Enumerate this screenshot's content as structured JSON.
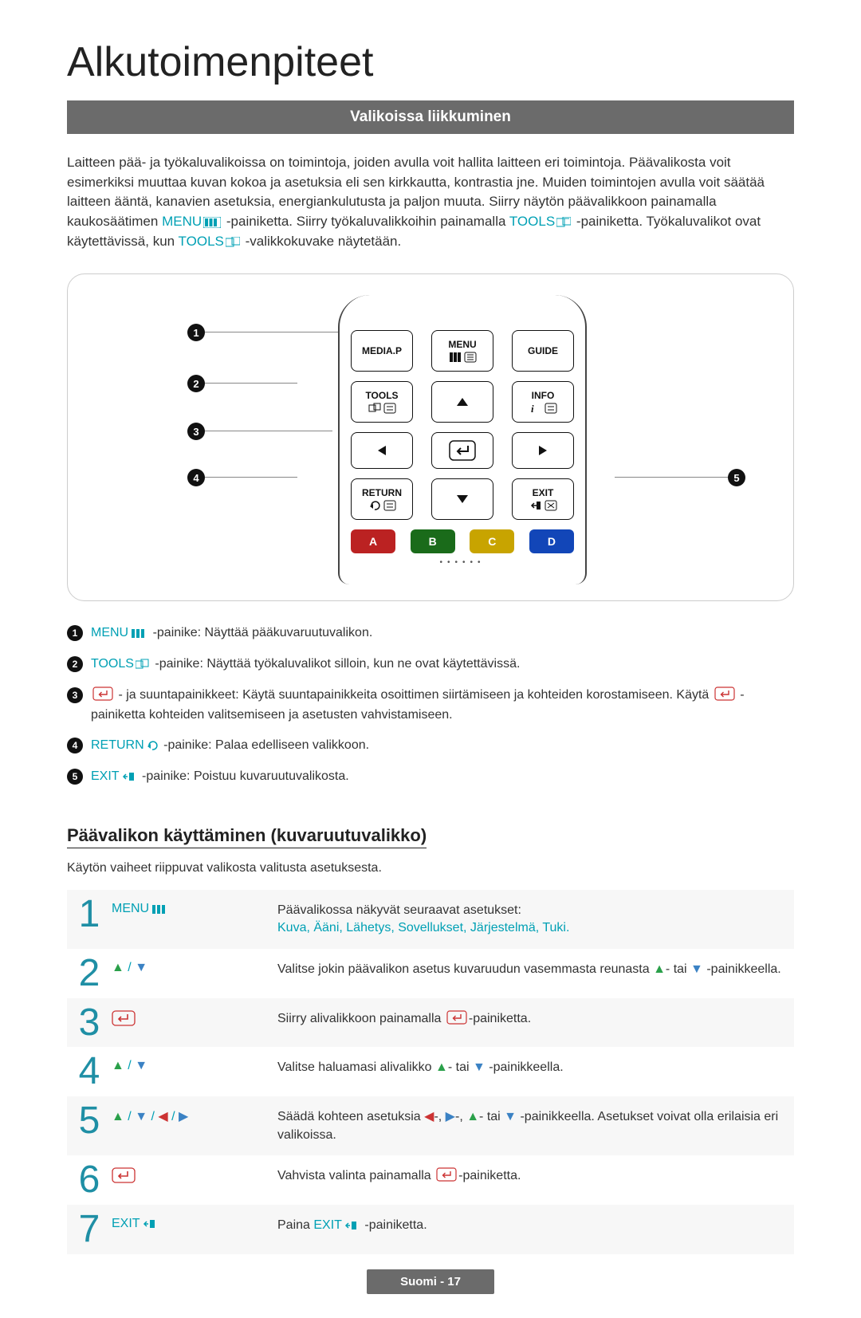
{
  "title": "Alkutoimenpiteet",
  "section_heading": "Valikoissa liikkuminen",
  "intro": {
    "text_before_menu": "Laitteen pää- ja työkaluvalikoissa on toimintoja, joiden avulla voit hallita laitteen eri toimintoja. Päävalikosta voit esimerkiksi muuttaa kuvan kokoa ja asetuksia eli sen kirkkautta, kontrastia jne. Muiden toimintojen avulla voit säätää laitteen ääntä, kanavien asetuksia, energiankulutusta ja paljon muuta. Siirry näytön päävalikkoon painamalla kaukosäätimen ",
    "menu_label": "MENU",
    "text_between": " -painiketta. Siirry työkaluvalikkoihin painamalla ",
    "tools_label": "TOOLS",
    "text_after_tools": " -painiketta. Työkaluvalikot ovat käytettävissä, kun ",
    "tools_label2": "TOOLS",
    "text_end": " -valikkokuvake näytetään."
  },
  "remote": {
    "buttons": {
      "media_p": "MEDIA.P",
      "menu": "MENU",
      "guide": "GUIDE",
      "tools": "TOOLS",
      "info": "INFO",
      "return": "RETURN",
      "exit": "EXIT"
    },
    "color_buttons": {
      "a": "A",
      "b": "B",
      "c": "C",
      "d": "D"
    },
    "callouts": {
      "n1": "1",
      "n2": "2",
      "n3": "3",
      "n4": "4",
      "n5": "5"
    }
  },
  "legend": [
    {
      "pre": "MENU",
      "text": " -painike: Näyttää pääkuvaruutuvalikon."
    },
    {
      "pre": "TOOLS",
      "text": " -painike: Näyttää työkaluvalikot silloin, kun ne ovat käytettävissä."
    },
    {
      "pre": "",
      "text": "- ja suuntapainikkeet: Käytä suuntapainikkeita osoittimen siirtämiseen ja kohteiden korostamiseen. Käytä ",
      "text2": "-painiketta kohteiden valitsemiseen ja asetusten vahvistamiseen."
    },
    {
      "pre": "RETURN",
      "text": " -painike: Palaa edelliseen valikkoon."
    },
    {
      "pre": "EXIT",
      "text": " -painike: Poistuu kuvaruutuvalikosta."
    }
  ],
  "sub_heading": "Päävalikon käyttäminen (kuvaruutuvalikko)",
  "sub_note": "Käytön vaiheet riippuvat valikosta valitusta asetuksesta.",
  "steps": [
    {
      "num": "1",
      "action": "MENU",
      "action_icon": "menu-icon",
      "desc_lead": "Päävalikossa näkyvät seuraavat asetukset:",
      "desc_links": "Kuva, Ääni, Lähetys, Sovellukset, Järjestelmä, Tuki."
    },
    {
      "num": "2",
      "action_icons": "updown",
      "desc_a": "Valitse jokin päävalikon asetus kuvaruudun vasemmasta reunasta ",
      "desc_b": "- tai ",
      "desc_c": " -painikkeella."
    },
    {
      "num": "3",
      "action_icons": "enter",
      "desc_a": "Siirry alivalikkoon painamalla ",
      "desc_b": "-painiketta."
    },
    {
      "num": "4",
      "action_icons": "updown",
      "desc_a": "Valitse haluamasi alivalikko ",
      "desc_b": "- tai ",
      "desc_c": " -painikkeella."
    },
    {
      "num": "5",
      "action_icons": "all4",
      "desc_a": "Säädä kohteen asetuksia ",
      "desc_b": "-, ",
      "desc_c": "-, ",
      "desc_d": "- tai ",
      "desc_e": " -painikkeella. Asetukset voivat olla erilaisia eri valikoissa."
    },
    {
      "num": "6",
      "action_icons": "enter",
      "desc_a": "Vahvista valinta painamalla ",
      "desc_b": "-painiketta."
    },
    {
      "num": "7",
      "action": "EXIT",
      "action_icon": "exit-icon",
      "desc_a": "Paina ",
      "desc_mid": "EXIT",
      "desc_b": " -painiketta."
    }
  ],
  "footer": "Suomi - 17"
}
